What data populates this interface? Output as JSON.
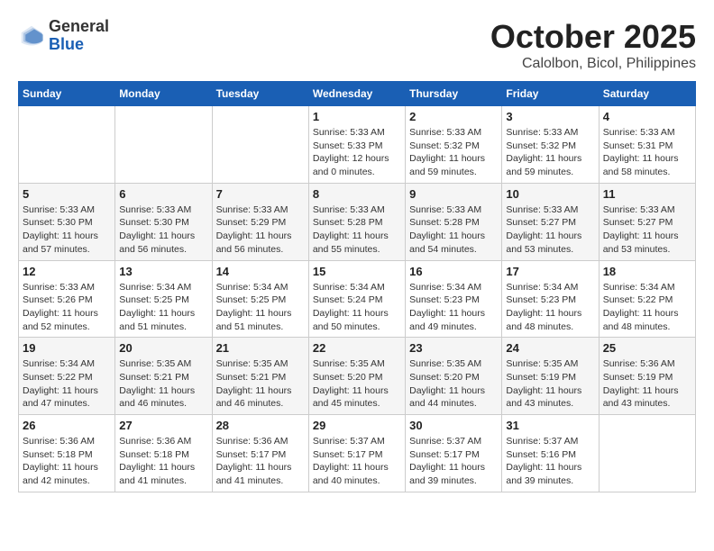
{
  "logo": {
    "general": "General",
    "blue": "Blue"
  },
  "header": {
    "month": "October 2025",
    "location": "Calolbon, Bicol, Philippines"
  },
  "weekdays": [
    "Sunday",
    "Monday",
    "Tuesday",
    "Wednesday",
    "Thursday",
    "Friday",
    "Saturday"
  ],
  "weeks": [
    [
      {
        "day": "",
        "info": ""
      },
      {
        "day": "",
        "info": ""
      },
      {
        "day": "",
        "info": ""
      },
      {
        "day": "1",
        "info": "Sunrise: 5:33 AM\nSunset: 5:33 PM\nDaylight: 12 hours\nand 0 minutes."
      },
      {
        "day": "2",
        "info": "Sunrise: 5:33 AM\nSunset: 5:32 PM\nDaylight: 11 hours\nand 59 minutes."
      },
      {
        "day": "3",
        "info": "Sunrise: 5:33 AM\nSunset: 5:32 PM\nDaylight: 11 hours\nand 59 minutes."
      },
      {
        "day": "4",
        "info": "Sunrise: 5:33 AM\nSunset: 5:31 PM\nDaylight: 11 hours\nand 58 minutes."
      }
    ],
    [
      {
        "day": "5",
        "info": "Sunrise: 5:33 AM\nSunset: 5:30 PM\nDaylight: 11 hours\nand 57 minutes."
      },
      {
        "day": "6",
        "info": "Sunrise: 5:33 AM\nSunset: 5:30 PM\nDaylight: 11 hours\nand 56 minutes."
      },
      {
        "day": "7",
        "info": "Sunrise: 5:33 AM\nSunset: 5:29 PM\nDaylight: 11 hours\nand 56 minutes."
      },
      {
        "day": "8",
        "info": "Sunrise: 5:33 AM\nSunset: 5:28 PM\nDaylight: 11 hours\nand 55 minutes."
      },
      {
        "day": "9",
        "info": "Sunrise: 5:33 AM\nSunset: 5:28 PM\nDaylight: 11 hours\nand 54 minutes."
      },
      {
        "day": "10",
        "info": "Sunrise: 5:33 AM\nSunset: 5:27 PM\nDaylight: 11 hours\nand 53 minutes."
      },
      {
        "day": "11",
        "info": "Sunrise: 5:33 AM\nSunset: 5:27 PM\nDaylight: 11 hours\nand 53 minutes."
      }
    ],
    [
      {
        "day": "12",
        "info": "Sunrise: 5:33 AM\nSunset: 5:26 PM\nDaylight: 11 hours\nand 52 minutes."
      },
      {
        "day": "13",
        "info": "Sunrise: 5:34 AM\nSunset: 5:25 PM\nDaylight: 11 hours\nand 51 minutes."
      },
      {
        "day": "14",
        "info": "Sunrise: 5:34 AM\nSunset: 5:25 PM\nDaylight: 11 hours\nand 51 minutes."
      },
      {
        "day": "15",
        "info": "Sunrise: 5:34 AM\nSunset: 5:24 PM\nDaylight: 11 hours\nand 50 minutes."
      },
      {
        "day": "16",
        "info": "Sunrise: 5:34 AM\nSunset: 5:23 PM\nDaylight: 11 hours\nand 49 minutes."
      },
      {
        "day": "17",
        "info": "Sunrise: 5:34 AM\nSunset: 5:23 PM\nDaylight: 11 hours\nand 48 minutes."
      },
      {
        "day": "18",
        "info": "Sunrise: 5:34 AM\nSunset: 5:22 PM\nDaylight: 11 hours\nand 48 minutes."
      }
    ],
    [
      {
        "day": "19",
        "info": "Sunrise: 5:34 AM\nSunset: 5:22 PM\nDaylight: 11 hours\nand 47 minutes."
      },
      {
        "day": "20",
        "info": "Sunrise: 5:35 AM\nSunset: 5:21 PM\nDaylight: 11 hours\nand 46 minutes."
      },
      {
        "day": "21",
        "info": "Sunrise: 5:35 AM\nSunset: 5:21 PM\nDaylight: 11 hours\nand 46 minutes."
      },
      {
        "day": "22",
        "info": "Sunrise: 5:35 AM\nSunset: 5:20 PM\nDaylight: 11 hours\nand 45 minutes."
      },
      {
        "day": "23",
        "info": "Sunrise: 5:35 AM\nSunset: 5:20 PM\nDaylight: 11 hours\nand 44 minutes."
      },
      {
        "day": "24",
        "info": "Sunrise: 5:35 AM\nSunset: 5:19 PM\nDaylight: 11 hours\nand 43 minutes."
      },
      {
        "day": "25",
        "info": "Sunrise: 5:36 AM\nSunset: 5:19 PM\nDaylight: 11 hours\nand 43 minutes."
      }
    ],
    [
      {
        "day": "26",
        "info": "Sunrise: 5:36 AM\nSunset: 5:18 PM\nDaylight: 11 hours\nand 42 minutes."
      },
      {
        "day": "27",
        "info": "Sunrise: 5:36 AM\nSunset: 5:18 PM\nDaylight: 11 hours\nand 41 minutes."
      },
      {
        "day": "28",
        "info": "Sunrise: 5:36 AM\nSunset: 5:17 PM\nDaylight: 11 hours\nand 41 minutes."
      },
      {
        "day": "29",
        "info": "Sunrise: 5:37 AM\nSunset: 5:17 PM\nDaylight: 11 hours\nand 40 minutes."
      },
      {
        "day": "30",
        "info": "Sunrise: 5:37 AM\nSunset: 5:17 PM\nDaylight: 11 hours\nand 39 minutes."
      },
      {
        "day": "31",
        "info": "Sunrise: 5:37 AM\nSunset: 5:16 PM\nDaylight: 11 hours\nand 39 minutes."
      },
      {
        "day": "",
        "info": ""
      }
    ]
  ]
}
